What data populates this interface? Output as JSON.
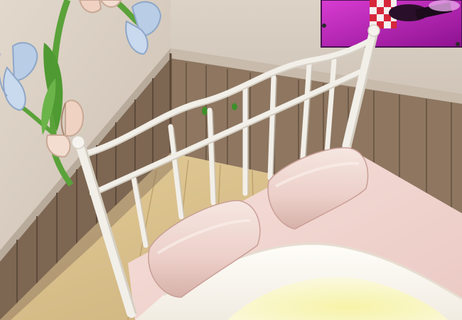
{
  "scene": {
    "palette": {
      "wall": "#d7ccbf",
      "wall_shadow": "#c2b6a8",
      "wainscot": "#8e7660",
      "wainscot_dark": "#6e5a48",
      "floor": "#d7c08e",
      "headboard": "#f2efe9",
      "pillow": "#f1dcd6",
      "sheet": "#f3d9d4",
      "blanket": "#fbf6f0",
      "blanket_inner": "#f3f1b8",
      "poster": "#c31fbf",
      "stem": "#5aa23a",
      "butterfly_blue": "#b9cde6",
      "butterfly_peach": "#efd2c2"
    },
    "objects": [
      {
        "name": "wall-left"
      },
      {
        "name": "wall-back"
      },
      {
        "name": "wainscot-panels"
      },
      {
        "name": "wood-floor"
      },
      {
        "name": "wall-poster"
      },
      {
        "name": "butterfly-flower-decal"
      },
      {
        "name": "iron-headboard"
      },
      {
        "name": "pillow-left"
      },
      {
        "name": "pillow-right"
      },
      {
        "name": "pink-bedsheet"
      },
      {
        "name": "white-blanket"
      }
    ]
  }
}
